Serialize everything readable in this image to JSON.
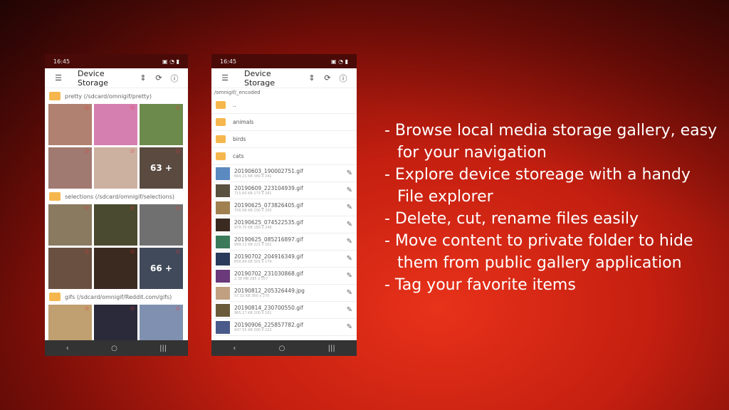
{
  "status_time": "16:45",
  "app_title": "Device Storage",
  "phone1": {
    "sections": [
      {
        "label": "pretty (/sdcard/omnigif/pretty)",
        "more": "63 +",
        "colors": [
          "#b08070",
          "#d57fb0",
          "#6c8a4c",
          "#a07a70",
          "#ccb0a0",
          "#5a4a40"
        ]
      },
      {
        "label": "selections (/sdcard/omnigif/selections)",
        "more": "66 +",
        "colors": [
          "#8a7a60",
          "#4a4a30",
          "#707070",
          "#6a5040",
          "#3a2a20",
          "#404a5a"
        ]
      },
      {
        "label": "gifs (/sdcard/omnigif/Reddit.com/gifs)",
        "colors": [
          "#c0a070",
          "#2a2a3a",
          "#8090b0"
        ]
      }
    ]
  },
  "phone2": {
    "path": "/omnigif/_encoded",
    "folders": [
      "..",
      "animals",
      "birds",
      "cats"
    ],
    "files": [
      {
        "name": "20190603_190002751.gif",
        "meta": "664.21 KB   360 x 241",
        "color": "#5a8ac0"
      },
      {
        "name": "20190609_223104939.gif",
        "meta": "715.60 KB   173 x 281",
        "color": "#5a5040"
      },
      {
        "name": "20190625_073826405.gif",
        "meta": "756.08 KB   200 x 200",
        "color": "#a08050"
      },
      {
        "name": "20190625_074522535.gif",
        "meta": "979.75 KB   180 x 248",
        "color": "#3a2a20"
      },
      {
        "name": "20190625_085216897.gif",
        "meta": "999.11 KB   221 x 201",
        "color": "#3a7a5a"
      },
      {
        "name": "20190702_204916349.gif",
        "meta": "858.89 KB   301 x 174",
        "color": "#2a3a5a"
      },
      {
        "name": "20190702_231030868.gif",
        "meta": "2.38 MB   285 x 557",
        "color": "#6a3a7a"
      },
      {
        "name": "20190812_205326449.jpg",
        "meta": "57.10 KB   360 x 270",
        "color": "#c0a080"
      },
      {
        "name": "20190814_230700550.gif",
        "meta": "965.17 KB   200 x 161",
        "color": "#6a5a3a"
      },
      {
        "name": "20190906_225857782.gif",
        "meta": "647.55 KB   300 x 223",
        "color": "#4a5a8a"
      }
    ]
  },
  "copy": [
    {
      "text": "- Browse local media storage gallery, easy",
      "indent": false
    },
    {
      "text": "for your navigation",
      "indent": true
    },
    {
      "text": "- Explore device storeage with a handy",
      "indent": false
    },
    {
      "text": "File explorer",
      "indent": true
    },
    {
      "text": "- Delete, cut, rename files easily",
      "indent": false
    },
    {
      "text": "- Move content to private folder to hide",
      "indent": false
    },
    {
      "text": "them from public gallery application",
      "indent": true
    },
    {
      "text": "- Tag your favorite items",
      "indent": false
    }
  ]
}
